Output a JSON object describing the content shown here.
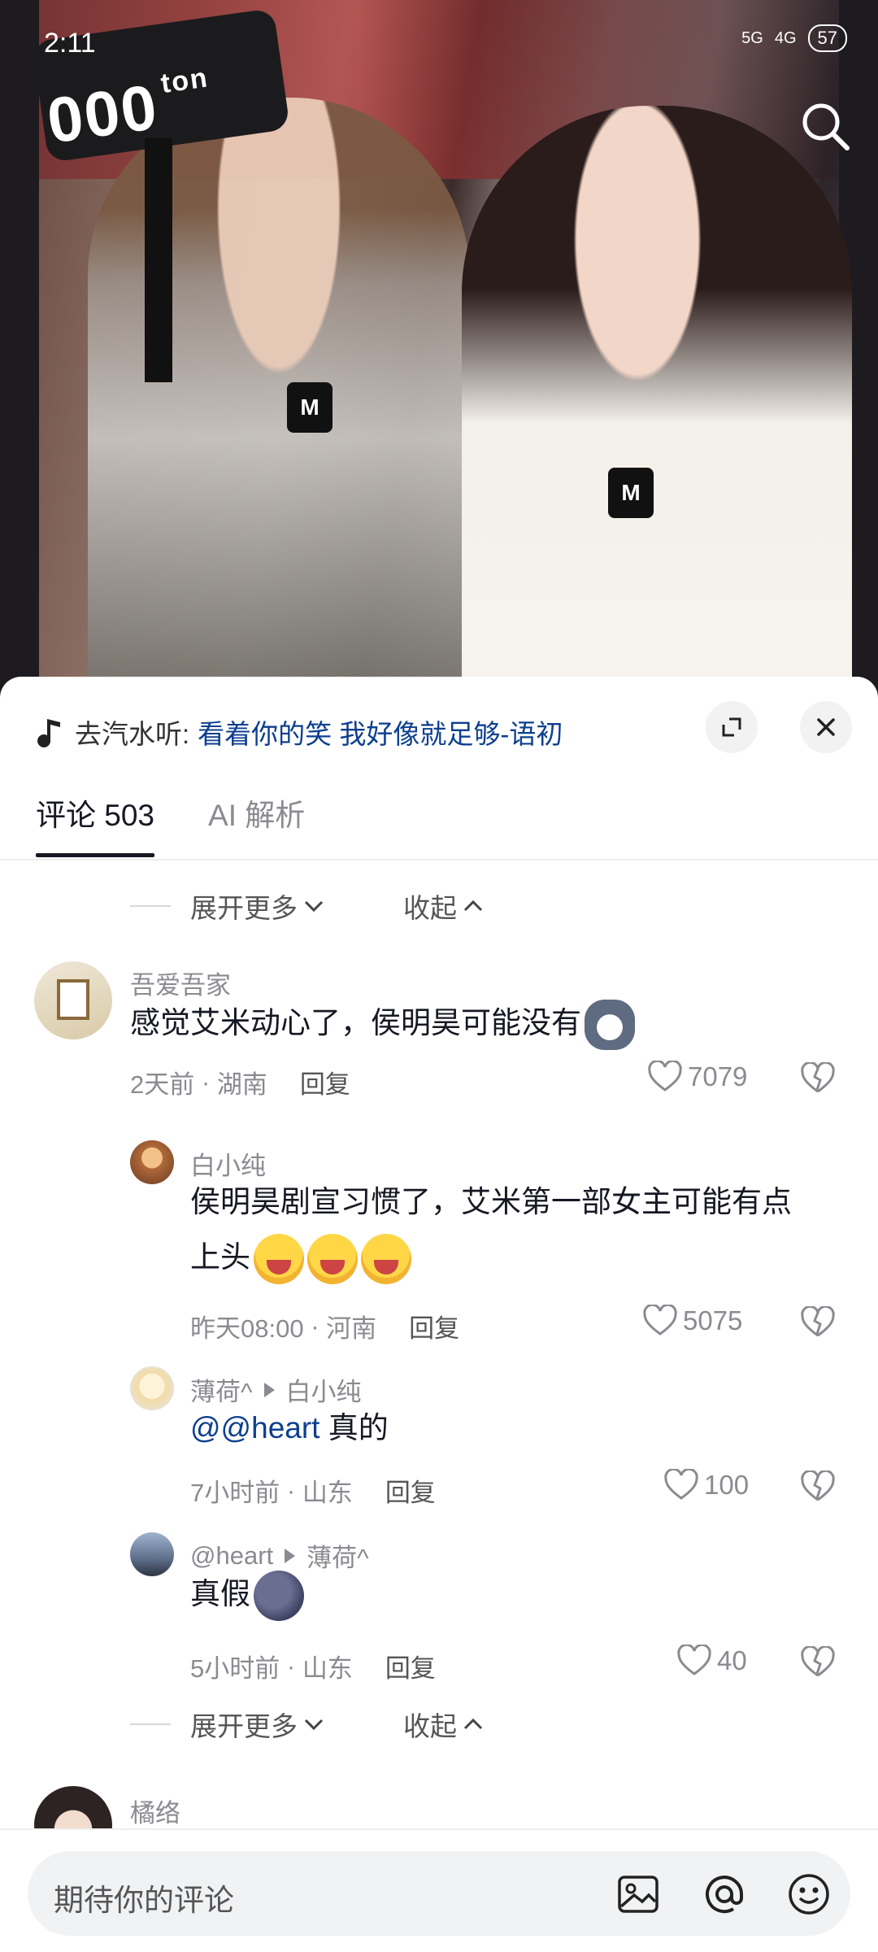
{
  "status_bar": {
    "time": "2:11",
    "network_1": "5G",
    "network_2": "4G",
    "battery": "57"
  },
  "video": {
    "hammer_label": "000",
    "hammer_unit": "ton",
    "mic_letter": "M"
  },
  "music": {
    "prefix": "去汽水听:",
    "song": "看着你的笑 我好像就足够-语初"
  },
  "tabs": [
    {
      "label": "评论 503",
      "active": true
    },
    {
      "label": "AI 解析",
      "active": false
    }
  ],
  "expand": {
    "more": "展开更多",
    "collapse": "收起"
  },
  "comments": [
    {
      "user": "吾爱吾家",
      "text": "感觉艾米动心了，侯明昊可能没有",
      "time": "2天前",
      "location": "湖南",
      "reply": "回复",
      "likes": "7079"
    },
    {
      "user": "白小纯",
      "text_line1": "侯明昊剧宣习惯了，艾米第一部女主可能有点",
      "text_line2": "上头",
      "time": "昨天08:00",
      "location": "河南",
      "reply": "回复",
      "likes": "5075"
    },
    {
      "user": "薄荷^",
      "reply_to": "白小纯",
      "mention": "@@heart",
      "text": " 真的",
      "time": "7小时前",
      "location": "山东",
      "reply": "回复",
      "likes": "100"
    },
    {
      "user": "@heart",
      "reply_to": "薄荷^",
      "text": "真假",
      "time": "5小时前",
      "location": "山东",
      "reply": "回复",
      "likes": "40"
    },
    {
      "user": "橘络"
    }
  ],
  "input": {
    "placeholder": "期待你的评论"
  }
}
